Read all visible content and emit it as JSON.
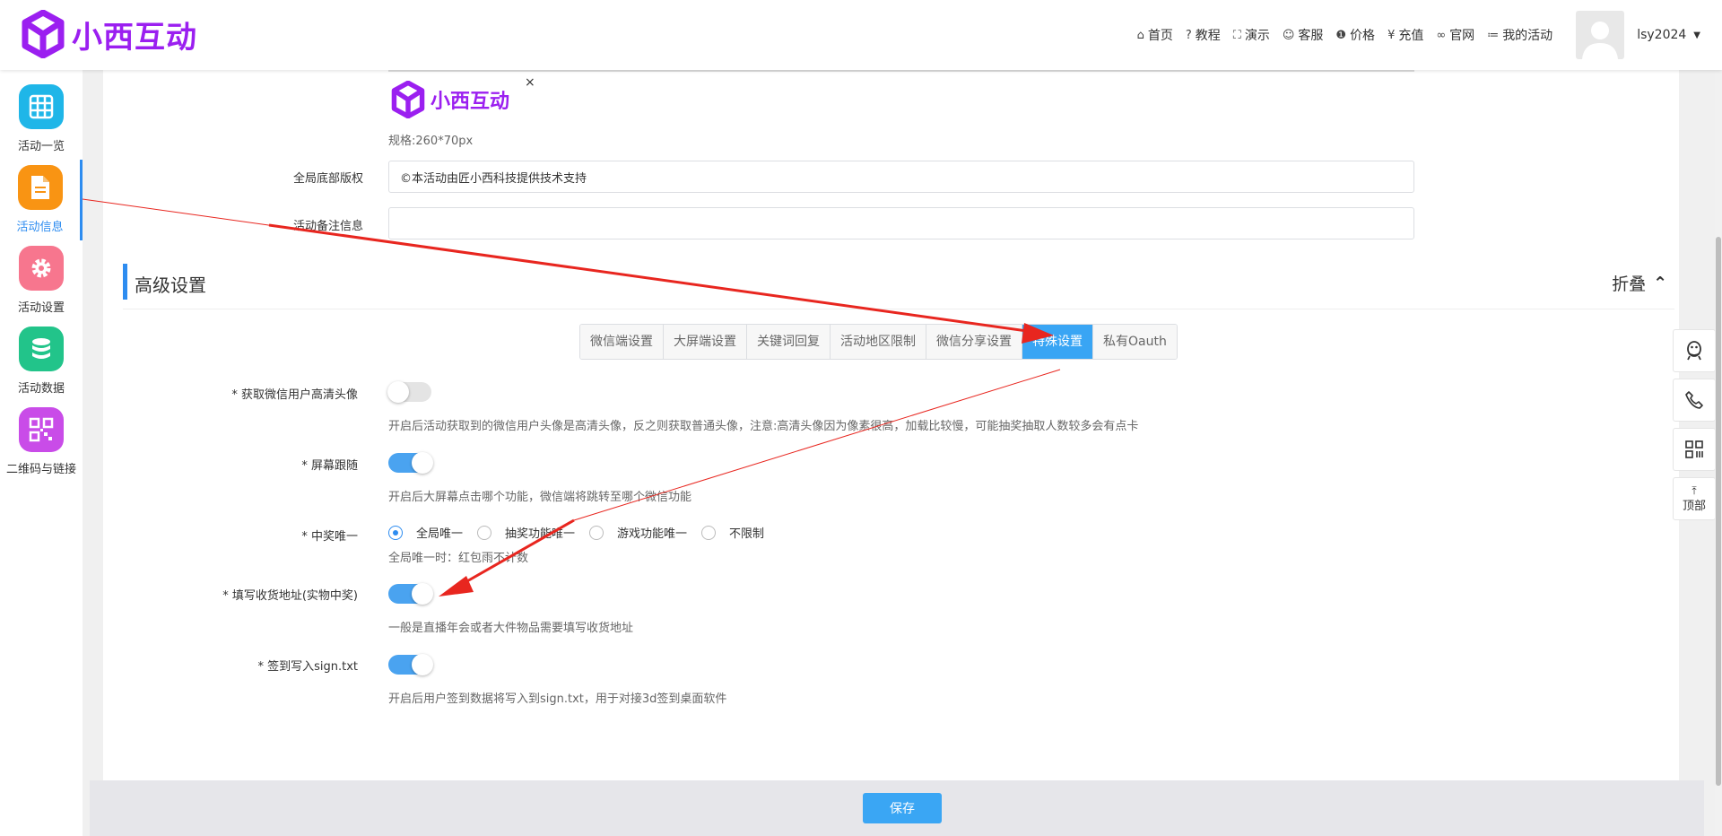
{
  "header": {
    "brand": "小西互动",
    "nav": [
      {
        "icon": "home-icon",
        "glyph": "⌂",
        "label": "首页"
      },
      {
        "icon": "question-icon",
        "glyph": "?",
        "label": "教程"
      },
      {
        "icon": "expand-icon",
        "glyph": "⛶",
        "label": "演示"
      },
      {
        "icon": "smile-icon",
        "glyph": "☺",
        "label": "客服"
      },
      {
        "icon": "info-icon",
        "glyph": "❶",
        "label": "价格"
      },
      {
        "icon": "yen-icon",
        "glyph": "¥",
        "label": "充值"
      },
      {
        "icon": "link-icon",
        "glyph": "∞",
        "label": "官网"
      },
      {
        "icon": "list-icon",
        "glyph": "≔",
        "label": "我的活动"
      }
    ],
    "username": "lsy2024"
  },
  "sidebar": {
    "items": [
      {
        "label": "活动一览",
        "color": "#1fb6e8",
        "icon": "grid-icon"
      },
      {
        "label": "活动信息",
        "color": "#f99413",
        "icon": "document-icon"
      },
      {
        "label": "活动设置",
        "color": "#f7768e",
        "icon": "gear-icon"
      },
      {
        "label": "活动数据",
        "color": "#22c48a",
        "icon": "database-icon"
      },
      {
        "label": "二维码与链接",
        "color": "#c94ce8",
        "icon": "qrcode-icon"
      }
    ]
  },
  "main": {
    "logo_preview_text": "小西互动",
    "close_glyph": "×",
    "spec": "规格:260*70px",
    "fields": {
      "footer_copyright_label": "全局底部版权",
      "footer_copyright_value": "©本活动由匠小西科技提供技术支持",
      "remark_label": "活动备注信息",
      "remark_value": ""
    },
    "section": {
      "title": "高级设置",
      "fold_label": "折叠",
      "fold_glyph": "⌃"
    },
    "tabs": [
      "微信端设置",
      "大屏端设置",
      "关键词回复",
      "活动地区限制",
      "微信分享设置",
      "特殊设置",
      "私有Oauth"
    ],
    "active_tab": "特殊设置",
    "settings": {
      "hd_avatar": {
        "label": "* 获取微信用户高清头像",
        "on": false,
        "hint": "开启后活动获取到的微信用户头像是高清头像，反之则获取普通头像，注意:高清头像因为像素很高，加载比较慢，可能抽奖抽取人数较多会有点卡"
      },
      "screen_follow": {
        "label": "* 屏幕跟随",
        "on": true,
        "hint": "开启后大屏幕点击哪个功能，微信端将跳转至哪个微信功能"
      },
      "unique_win": {
        "label": "* 中奖唯一",
        "options": [
          "全局唯一",
          "抽奖功能唯一",
          "游戏功能唯一",
          "不限制"
        ],
        "selected": "全局唯一",
        "hint": "全局唯一时：红包雨不计数"
      },
      "address": {
        "label": "* 填写收货地址(实物中奖)",
        "on": true,
        "hint": "一般是直播年会或者大件物品需要填写收货地址"
      },
      "sign_txt": {
        "label": "* 签到写入sign.txt",
        "on": true,
        "hint": "开启后用户签到数据将写入到sign.txt，用于对接3d签到桌面软件"
      }
    }
  },
  "footer": {
    "save_label": "保存"
  },
  "tools": {
    "top_label": "顶部",
    "top_glyph": "⤒"
  },
  "annotation_color": "#e8261f"
}
